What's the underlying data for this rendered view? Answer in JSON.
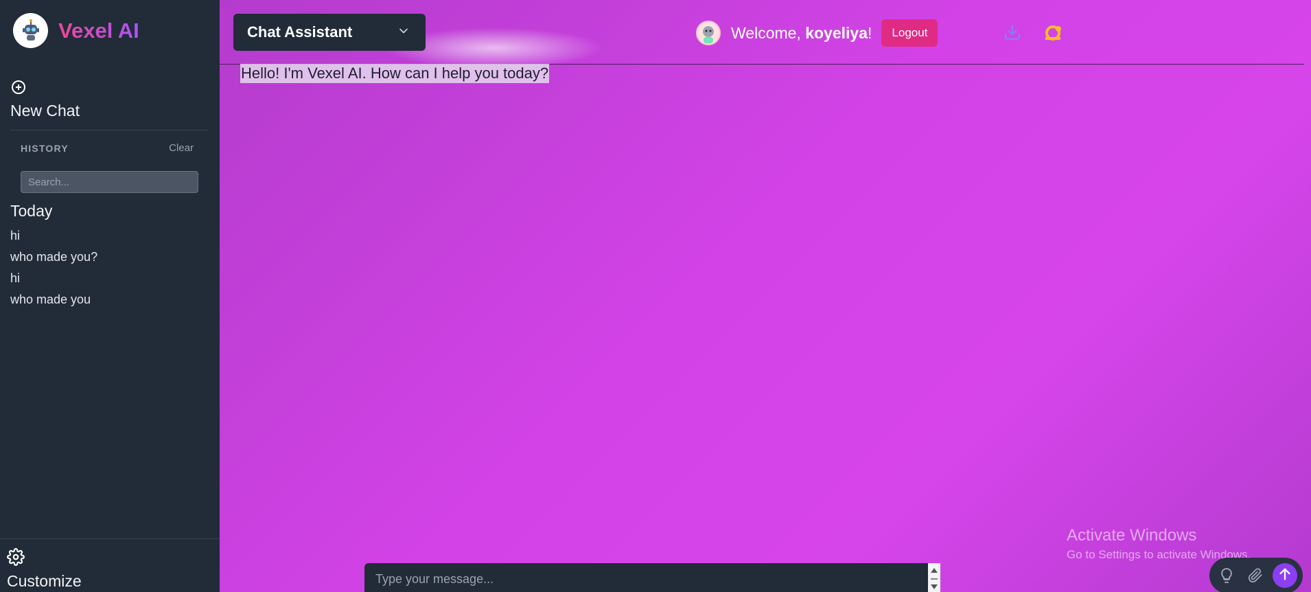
{
  "brand": {
    "name": "Vexel AI",
    "logo_icon": "robot-icon"
  },
  "sidebar": {
    "new_chat_label": "New Chat",
    "history_title": "HISTORY",
    "clear_label": "Clear",
    "search_placeholder": "Search...",
    "group_title": "Today",
    "items": [
      {
        "label": "hi"
      },
      {
        "label": "who made you?"
      },
      {
        "label": "hi"
      },
      {
        "label": "who made you"
      }
    ],
    "customize_label": "Customize"
  },
  "header": {
    "model_selected": "Chat Assistant",
    "welcome_prefix": "Welcome, ",
    "username": "koyeliya",
    "welcome_suffix": "!",
    "logout_label": "Logout"
  },
  "chat": {
    "greeting": "Hello! I'm Vexel AI. How can I help you today?",
    "input_placeholder": "Type your message..."
  },
  "watermark": {
    "title": "Activate Windows",
    "subtitle": "Go to Settings to activate Windows."
  },
  "colors": {
    "sidebar_bg": "#222b38",
    "accent_pink": "#e02b84",
    "accent_purple": "#8b3ff0",
    "main_gradient_mid": "#d642e9"
  }
}
